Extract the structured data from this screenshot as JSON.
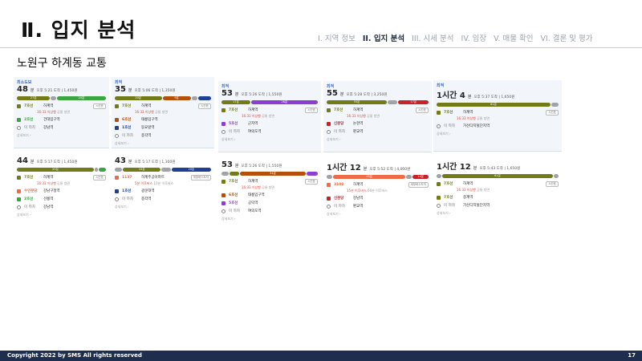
{
  "header": {
    "title": "Ⅱ. 입지 분석",
    "nav": [
      "I. 지역 정보",
      "II. 입지 분석",
      "III. 시세 분석",
      "IV. 임장",
      "V. 매물 확인",
      "VI. 결론 및 평가"
    ],
    "active_index": 1,
    "subtitle": "노원구 하계동 교통"
  },
  "footer": {
    "copyright": "Copyright 2022 by SMS All rights reserved",
    "page": "17"
  },
  "colors": {
    "line7": "#737b19",
    "line6": "#b5500b",
    "line5": "#8b3fd1",
    "line2": "#3ba640",
    "line1": "#1e3f94",
    "shinbundang": "#c82127",
    "bus": "#f06a45",
    "gray": "#a0a4a8"
  },
  "columns": [
    {
      "cards": [
        {
          "label": "최소도보",
          "mins": "48",
          "unit": "분",
          "meta": "오후 5:21 도착 | 1,450원",
          "bar": [
            {
              "c": "line7",
              "w": 38,
              "t": "27분"
            },
            {
              "c": "gray",
              "w": 6,
              "t": ""
            },
            {
              "c": "line2",
              "w": 56,
              "t": "20분"
            }
          ],
          "rows": [
            {
              "ico": "line7",
              "line": "7호선",
              "station": "하계역",
              "sub": "16:33 이상행",
              "sub2": "공릉 방면",
              "btn": "시간표"
            },
            {
              "ico": "line2",
              "line": "2호선",
              "station": "건대입구역"
            },
            {
              "ico": "gray",
              "line": "이 하차",
              "station": "강남역"
            }
          ],
          "more": "상세보기 ›"
        },
        {
          "label": "",
          "mins": "44",
          "unit": "분",
          "meta": "오후 5:17 도착 | 1,450원",
          "bar": [
            {
              "c": "line7",
              "w": 88,
              "t": "25분"
            },
            {
              "c": "gray",
              "w": 4,
              "t": ""
            },
            {
              "c": "line2",
              "w": 8,
              "t": ""
            }
          ],
          "rows": [
            {
              "ico": "line7",
              "line": "7호선",
              "station": "하계역",
              "sub": "16:33 이상행",
              "sub2": "공릉 방면",
              "btn": "시간표"
            },
            {
              "ico": "bus",
              "line": "수인분당",
              "station": "강남구청역"
            },
            {
              "ico": "line2",
              "line": "2호선",
              "station": "선릉역"
            },
            {
              "ico": "gray",
              "line": "이 하차",
              "station": "강남역"
            }
          ],
          "more": "상세보기 ›"
        }
      ]
    },
    {
      "cards": [
        {
          "label": "최적",
          "mins": "35",
          "unit": "분",
          "meta": "오후 5:06 도착 | 1,350원",
          "bar": [
            {
              "c": "line7",
              "w": 50,
              "t": "20분"
            },
            {
              "c": "line6",
              "w": 30,
              "t": "9분"
            },
            {
              "c": "gray",
              "w": 6,
              "t": ""
            },
            {
              "c": "line1",
              "w": 14,
              "t": ""
            }
          ],
          "rows": [
            {
              "ico": "line7",
              "line": "7호선",
              "station": "하계역",
              "sub": "16:33 이상행",
              "sub2": "공릉 방면",
              "btn": "시간표"
            },
            {
              "ico": "line6",
              "line": "6호선",
              "station": "태릉입구역"
            },
            {
              "ico": "line1",
              "line": "1호선",
              "station": "동묘앞역"
            },
            {
              "ico": "gray",
              "line": "이 하차",
              "station": "종각역"
            }
          ],
          "more": "상세보기 ›"
        },
        {
          "label": "",
          "mins": "43",
          "unit": "분",
          "meta": "오후 5:17 도착 | 1,300원",
          "bar": [
            {
              "c": "gray",
              "w": 8,
              "t": ""
            },
            {
              "c": "line7",
              "w": 40,
              "t": "15분"
            },
            {
              "c": "gray",
              "w": 10,
              "t": ""
            },
            {
              "c": "line1",
              "w": 42,
              "t": "20분"
            }
          ],
          "rows": [
            {
              "ico": "bus",
              "line": "1137",
              "station": "하계주공아파트",
              "sub": "5분 이후버스",
              "sub2": "10분 이후버스",
              "btn": "세부버스도착"
            },
            {
              "ico": "line1",
              "line": "1호선",
              "station": "광운대역"
            },
            {
              "ico": "gray",
              "line": "이 하차",
              "station": "종각역"
            }
          ],
          "more": "상세보기 ›"
        }
      ]
    },
    {
      "cards": [
        {
          "label": "최적",
          "mins": "53",
          "unit": "분",
          "meta": "오후 5:26 도착 | 1,550원",
          "bar": [
            {
              "c": "line7",
              "w": 30,
              "t": "17분"
            },
            {
              "c": "line5",
              "w": 70,
              "t": "28분"
            }
          ],
          "rows": [
            {
              "ico": "line7",
              "line": "7호선",
              "station": "하계역",
              "sub": "16:33 이상행",
              "sub2": "공릉 방면",
              "btn": "시간표"
            },
            {
              "ico": "line5",
              "line": "5호선",
              "station": "군자역"
            },
            {
              "ico": "gray",
              "line": "이 하차",
              "station": "여의도역"
            }
          ],
          "more": "상세보기 ›"
        },
        {
          "label": "",
          "mins": "53",
          "unit": "분",
          "meta": "오후 5:26 도착 | 1,550원",
          "bar": [
            {
              "c": "gray",
              "w": 8,
              "t": ""
            },
            {
              "c": "line7",
              "w": 10,
              "t": ""
            },
            {
              "c": "line6",
              "w": 70,
              "t": "34분"
            },
            {
              "c": "line5",
              "w": 12,
              "t": ""
            }
          ],
          "rows": [
            {
              "ico": "line7",
              "line": "7호선",
              "station": "하계역",
              "sub": "16:33 이상행",
              "sub2": "공릉 방면",
              "btn": "시간표"
            },
            {
              "ico": "line6",
              "line": "6호선",
              "station": "태릉입구역"
            },
            {
              "ico": "line5",
              "line": "5호선",
              "station": "공덕역"
            },
            {
              "ico": "gray",
              "line": "이 하차",
              "station": "여의도역"
            }
          ],
          "more": "상세보기 ›"
        }
      ]
    },
    {
      "cards": [
        {
          "label": "최적",
          "mins": "55",
          "unit": "분",
          "meta": "오후 5:28 도착 | 3,250원",
          "bar": [
            {
              "c": "line7",
              "w": 60,
              "t": "33분"
            },
            {
              "c": "gray",
              "w": 10,
              "t": ""
            },
            {
              "c": "shinbundang",
              "w": 30,
              "t": "17분"
            }
          ],
          "rows": [
            {
              "ico": "line7",
              "line": "7호선",
              "station": "하계역",
              "sub": "16:33 이상행",
              "sub2": "공릉 방면",
              "btn": "시간표"
            },
            {
              "ico": "shinbundang",
              "line": "신분당",
              "station": "논현역"
            },
            {
              "ico": "gray",
              "line": "이 하차",
              "station": "판교역"
            }
          ],
          "more": "상세보기 ›"
        },
        {
          "label": "",
          "mins": "1시간 12",
          "unit": "분",
          "meta": "오후 5:52 도착 | 4,000원",
          "bar": [
            {
              "c": "gray",
              "w": 6,
              "t": ""
            },
            {
              "c": "bus",
              "w": 72,
              "t": "46분"
            },
            {
              "c": "gray",
              "w": 6,
              "t": ""
            },
            {
              "c": "shinbundang",
              "w": 16,
              "t": "14분"
            }
          ],
          "rows": [
            {
              "ico": "bus",
              "line": "3100",
              "station": "하계역",
              "sub": "15분 이후버스",
              "sub2": "66분 이후버스",
              "btn": "세부버스도착"
            },
            {
              "ico": "shinbundang",
              "line": "신분당",
              "station": "강남역"
            },
            {
              "ico": "gray",
              "line": "이 하차",
              "station": "판교역"
            }
          ],
          "more": "상세보기 ›"
        }
      ]
    },
    {
      "cards": [
        {
          "label": "최적",
          "mins": "1시간 4",
          "unit": "분",
          "meta": "오후 5:37 도착 | 1,650원",
          "bar": [
            {
              "c": "line7",
              "w": 94,
              "t": "61분"
            },
            {
              "c": "gray",
              "w": 6,
              "t": ""
            }
          ],
          "rows": [
            {
              "ico": "line7",
              "line": "7호선",
              "station": "하계역",
              "sub": "16:33 이상행",
              "sub2": "공릉 방면",
              "btn": "시간표"
            },
            {
              "ico": "gray",
              "line": "이 하차",
              "station": "가산디지털단지역"
            }
          ],
          "more": "상세보기 ›"
        },
        {
          "label": "",
          "mins": "1시간 12",
          "unit": "분",
          "meta": "오후 5:43 도착 | 1,650원",
          "bar": [
            {
              "c": "gray",
              "w": 4,
              "t": ""
            },
            {
              "c": "line7",
              "w": 92,
              "t": "61분"
            },
            {
              "c": "gray",
              "w": 4,
              "t": ""
            }
          ],
          "rows": [
            {
              "ico": "line7",
              "line": "7호선",
              "station": "하계역",
              "sub": "16:33 이상행",
              "sub2": "공릉 방면",
              "btn": "시간표"
            },
            {
              "ico": "line7",
              "line": "7호선",
              "station": "중계역"
            },
            {
              "ico": "gray",
              "line": "이 하차",
              "station": "가산디지털단지역"
            }
          ],
          "more": "상세보기 ›"
        }
      ]
    }
  ]
}
